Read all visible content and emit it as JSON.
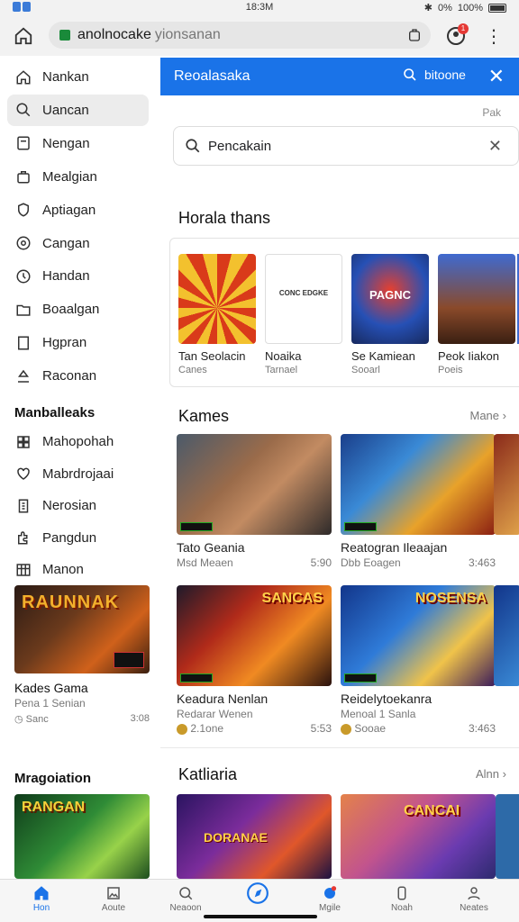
{
  "status": {
    "time": "18:3M",
    "battery": "100%",
    "signal": "0%"
  },
  "browser": {
    "host": "anolnocake",
    "path": "yionsanan",
    "badge": "1"
  },
  "sidebar": {
    "items": [
      {
        "label": "Nankan",
        "icon": "home-icon"
      },
      {
        "label": "Uancan",
        "icon": "search-icon"
      },
      {
        "label": "Nengan",
        "icon": "file-icon"
      },
      {
        "label": "Mealgian",
        "icon": "bag-icon"
      },
      {
        "label": "Aptiagan",
        "icon": "shield-icon"
      },
      {
        "label": "Cangan",
        "icon": "target-icon"
      },
      {
        "label": "Handan",
        "icon": "clock-icon"
      },
      {
        "label": "Boaalgan",
        "icon": "folder-icon"
      },
      {
        "label": "Hgpran",
        "icon": "bookmark-icon"
      },
      {
        "label": "Raconan",
        "icon": "upload-icon"
      }
    ],
    "section1": "Manballeaks",
    "items2": [
      {
        "label": "Mahopohah",
        "icon": "grid-icon"
      },
      {
        "label": "Mabrdrojaai",
        "icon": "heart-icon"
      },
      {
        "label": "Nerosian",
        "icon": "building-icon"
      },
      {
        "label": "Pangdun",
        "icon": "puzzle-icon"
      },
      {
        "label": "Manon",
        "icon": "apps-icon"
      }
    ],
    "card1": {
      "art_text": "RAUNNAK",
      "name": "Kades Gama",
      "sub": "Pena 1 Senian",
      "meta": "Sanc",
      "count": "3:08"
    },
    "section2": "Mragoiation",
    "card2": {
      "art_text": "RANGAN"
    }
  },
  "main": {
    "topbar": {
      "title": "Reoalasaka",
      "search": "bitoone"
    },
    "top_right": "Pak",
    "search_placeholder": "Pencakain",
    "section1": "Horala thans",
    "tiles": [
      {
        "name": "Tan Seolacin",
        "sub": "Canes",
        "art": "sun"
      },
      {
        "name": "Noaika",
        "sub": "Tarnael",
        "art": "plain",
        "art_text": "CONC EDGKE"
      },
      {
        "name": "Se Kamiean",
        "sub": "Sooarl",
        "art": "hero",
        "art_text": "PAGNC"
      },
      {
        "name": "Peok Iiakon",
        "sub": "Poeis",
        "art": "warrior"
      }
    ],
    "section2": "Kames",
    "section2_more": "Mane",
    "cards": [
      {
        "name": "Tato Geania",
        "sub": "Msd Meaen",
        "count": "5:90"
      },
      {
        "name": "Reatogran Ileaajan",
        "sub": "Dbb Eoagen",
        "count": "3:463"
      },
      {
        "name": "Keadura Nenlan",
        "sub": "Redarar Wenen",
        "meta": "2.1one",
        "count": "5:53",
        "art_text": "SANCAS"
      },
      {
        "name": "Reidelytoekanra",
        "sub": "Menoal 1 Sanla",
        "meta": "Sooae",
        "count": "3:463",
        "art_text": "NOSENSA"
      }
    ],
    "section3": "Katliaria",
    "section3_more": "Alnn",
    "row3": [
      {
        "art_text": "DORANAE"
      },
      {
        "art_text": "CANCAI"
      }
    ]
  },
  "nav": [
    {
      "label": "Hon",
      "icon": "home-icon",
      "active": true
    },
    {
      "label": "Aoute",
      "icon": "image-icon"
    },
    {
      "label": "Neaoon",
      "icon": "chat-icon"
    },
    {
      "label": "",
      "icon": "compass-icon"
    },
    {
      "label": "Mgile",
      "icon": "bell-icon"
    },
    {
      "label": "Noah",
      "icon": "phone-icon"
    },
    {
      "label": "Neates",
      "icon": "profile-icon"
    }
  ]
}
